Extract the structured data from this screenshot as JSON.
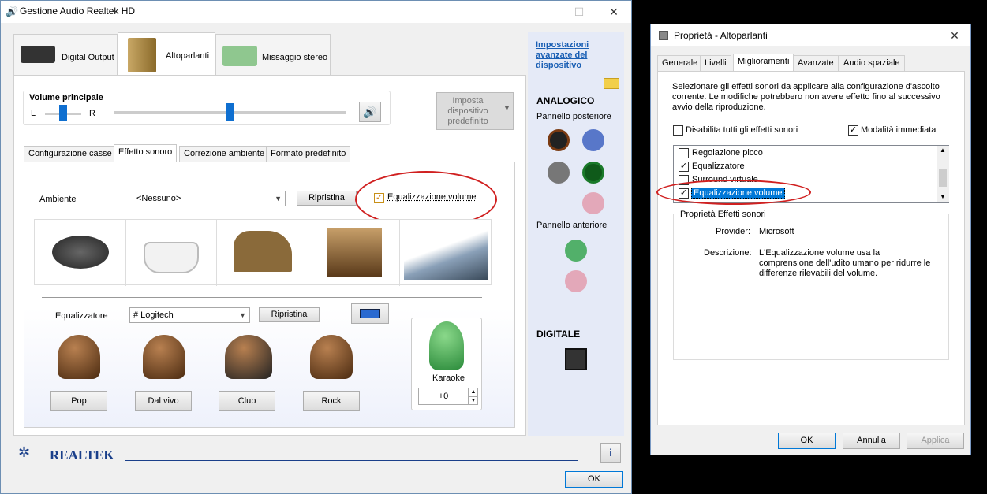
{
  "realtek": {
    "title": "Gestione Audio Realtek HD",
    "device_tabs": [
      "Digital Output",
      "Altoparlanti",
      "Missaggio stereo"
    ],
    "volume": {
      "label": "Volume principale",
      "left": "L",
      "right": "R",
      "balance_level": 0.5,
      "volume_level": 0.5
    },
    "default_device_btn": "Imposta dispositivo predefinito",
    "sub_tabs": [
      "Configurazione casse",
      "Effetto sonoro",
      "Correzione ambiente",
      "Formato predefinito"
    ],
    "ambient": {
      "label": "Ambiente",
      "value": "<Nessuno>",
      "reset": "Ripristina"
    },
    "loudness": {
      "label": "Equalizzazione volume",
      "checked": true
    },
    "equalizer": {
      "label": "Equalizzatore",
      "value": "# Logitech",
      "reset": "Ripristina"
    },
    "presets": [
      "Pop",
      "Dal vivo",
      "Club",
      "Rock"
    ],
    "karaoke": {
      "label": "Karaoke",
      "value": "+0"
    },
    "advanced_link": "Impostazioni avanzate del dispositivo",
    "analog": "ANALOGICO",
    "rear_panel": "Pannello posteriore",
    "front_panel": "Pannello anteriore",
    "digital": "DIGITALE",
    "brand": "REALTEK",
    "ok": "OK",
    "colors": {
      "link": "#1a5fb4",
      "jack_rear": [
        "#7a3a12",
        "#5877c9",
        "#777777",
        "#1a7a2a",
        "#e3a8b9"
      ],
      "jack_front": [
        "#52b06a",
        "#e3a8b9"
      ]
    }
  },
  "props": {
    "title": "Proprietà - Altoparlanti",
    "tabs": [
      "Generale",
      "Livelli",
      "Miglioramenti",
      "Avanzate",
      "Audio spaziale"
    ],
    "intro": "Selezionare gli effetti sonori da applicare alla configurazione d'ascolto corrente. Le modifiche potrebbero non avere effetto fino al successivo avvio della riproduzione.",
    "disable_all": "Disabilita tutti gli effetti sonori",
    "immediate": "Modalità immediata",
    "effects": [
      {
        "label": "Regolazione picco",
        "checked": false
      },
      {
        "label": "Equalizzatore",
        "checked": true
      },
      {
        "label": "Surround virtuale",
        "checked": false
      },
      {
        "label": "Equalizzazione volume",
        "checked": true
      }
    ],
    "group_title": "Proprietà Effetti sonori",
    "provider_label": "Provider:",
    "provider_value": "Microsoft",
    "desc_label": "Descrizione:",
    "desc_value": "L'Equalizzazione volume usa la comprensione dell'udito umano per ridurre le differenze rilevabili del volume.",
    "ok": "OK",
    "cancel": "Annulla",
    "apply": "Applica"
  }
}
